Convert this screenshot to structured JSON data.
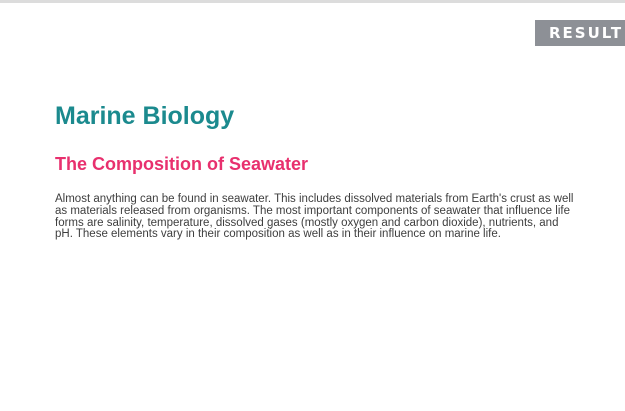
{
  "badge": {
    "label": "RESULT"
  },
  "slide": {
    "title": "Marine Biology",
    "heading": "The Composition of Seawater",
    "body": "Almost anything can be found in seawater. This includes dissolved materials from Earth's crust as well as materials released from organisms. The most important components of seawater that influence life forms are salinity, temperature, dissolved gases (mostly oxygen and carbon dioxide), nutrients, and pH. These elements vary in their composition as well as in their influence on marine life."
  },
  "colors": {
    "title": "#1b8a8e",
    "heading": "#e8306e",
    "badge_bg": "#8d9096"
  }
}
